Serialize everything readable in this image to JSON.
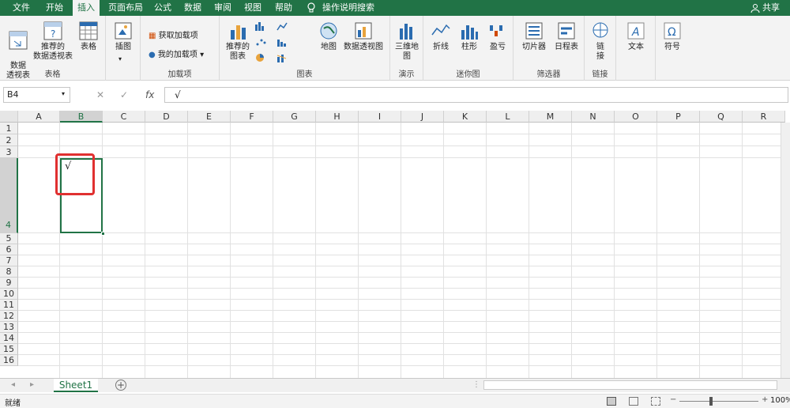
{
  "tabs": [
    "文件",
    "开始",
    "插入",
    "页面布局",
    "公式",
    "数据",
    "审阅",
    "视图",
    "帮助"
  ],
  "active_tab": "插入",
  "tell_me": "操作说明搜索",
  "share": "共享",
  "ribbon": {
    "tables": {
      "label": "表格",
      "pivot": "数据\n透视表",
      "rec_pivot": "推荐的\n数据透视表",
      "table": "表格"
    },
    "illus": {
      "label": "插图"
    },
    "addins": {
      "label": "加载项",
      "get": "获取加载项",
      "my": "我的加载项"
    },
    "charts": {
      "label": "图表",
      "rec": "推荐的\n图表",
      "map": "地图",
      "pivotchart": "数据透视图"
    },
    "tours": {
      "label": "演示",
      "map3d": "三维地\n图"
    },
    "spark": {
      "label": "迷你图",
      "line": "折线",
      "column": "柱形",
      "winloss": "盈亏"
    },
    "filters": {
      "label": "筛选器",
      "slicer": "切片器",
      "timeline": "日程表"
    },
    "links": {
      "label": "链接",
      "link": "链\n接"
    },
    "text": {
      "text": "文本"
    },
    "symbols": {
      "symbol": "符号"
    }
  },
  "formula_bar": {
    "name_box": "B4",
    "fx": "fx",
    "value": "√"
  },
  "columns": [
    "A",
    "B",
    "C",
    "D",
    "E",
    "F",
    "G",
    "H",
    "I",
    "J",
    "K",
    "L",
    "M",
    "N",
    "O",
    "P",
    "Q",
    "R"
  ],
  "rows": [
    "1",
    "2",
    "3",
    "4",
    "5",
    "6",
    "7",
    "8",
    "9",
    "10",
    "11",
    "12",
    "13",
    "14",
    "15",
    "16"
  ],
  "cell_b4": "√",
  "sheet_tab": "Sheet1",
  "status": {
    "ready": "就绪",
    "zoom": "100%"
  },
  "colors": {
    "excel_green": "#217346",
    "highlight": "#e03030"
  }
}
